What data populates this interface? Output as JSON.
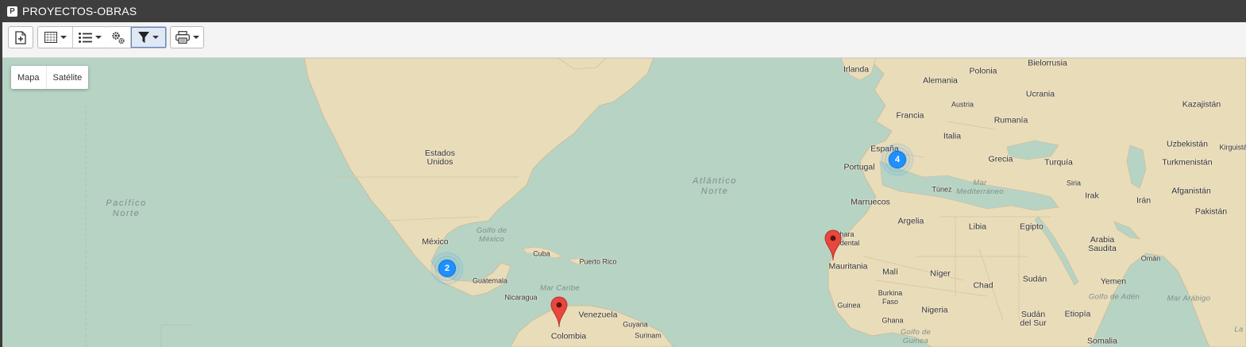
{
  "window": {
    "title": "PROYECTOS-OBRAS",
    "logo_letter": "P"
  },
  "toolbar": {
    "buttons": [
      {
        "name": "new-record-button",
        "icon": "file-plus-icon"
      },
      {
        "name": "grid-view-button",
        "icon": "grid-icon",
        "dropdown": true
      },
      {
        "name": "list-view-button",
        "icon": "list-icon",
        "dropdown": true
      },
      {
        "name": "settings-button",
        "icon": "gears-icon"
      },
      {
        "name": "filter-button",
        "icon": "filter-icon",
        "dropdown": true,
        "active": true
      },
      {
        "name": "print-button",
        "icon": "printer-icon",
        "dropdown": true
      }
    ]
  },
  "map": {
    "type_control": {
      "map": "Mapa",
      "satellite": "Satélite",
      "selected": "Mapa"
    },
    "labels": {
      "irlanda": "Irlanda",
      "polonia": "Polonia",
      "bielorrusia": "Bielorrusia",
      "alemania": "Alemania",
      "ucrania": "Ucrania",
      "austria": "Austria",
      "kazajistan": "Kazajistán",
      "francia": "Francia",
      "rumania": "Rumanía",
      "italia": "Italia",
      "uzbekistan": "Uzbekistán",
      "kirguistan": "Kirguistá",
      "espana": "España",
      "portugal": "Portugal",
      "grecia": "Grecia",
      "turquia": "Turquía",
      "turkmenistan": "Turkmenistán",
      "siria": "Siria",
      "tunez": "Túnez",
      "mar_mediterraneo": "Mar\nMediterráneo",
      "irak": "Irak",
      "afganistan": "Afganistán",
      "iran": "Irán",
      "marruecos": "Marruecos",
      "pakistan": "Pakistán",
      "argelia": "Argelia",
      "libia": "Libia",
      "egipto": "Egipto",
      "arabia_saudita": "Arabia\nSaudita",
      "sahara_occidental": "Sahara\nOccidental",
      "oman": "Omán",
      "mauritania": "Mauritania",
      "mali": "Malí",
      "niger": "Níger",
      "chad": "Chad",
      "sudan": "Sudán",
      "yemen": "Yemen",
      "golfo_aden": "Golfo de Adén",
      "mar_arabigo": "Mar Arábigo",
      "burkina_faso": "Burkina\nFaso",
      "guinea": "Guinea",
      "nigeria": "Nigeria",
      "sudan_sur": "Sudán\ndel Sur",
      "etiopia": "Etiopía",
      "ghana": "Ghana",
      "golfo_guinea": "Golfo de\nGuinea",
      "somalia": "Somalia",
      "estados_unidos": "Estados\nUnidos",
      "atlantico_norte": "Atlántico\nNorte",
      "pacifico_norte": "Pacífico\nNorte",
      "mexico": "México",
      "golfo_mexico": "Golfo de\nMéxico",
      "cuba": "Cuba",
      "puerto_rico": "Puerto Rico",
      "guatemala": "Guatemala",
      "mar_caribe": "Mar Caribe",
      "nicaragua": "Nicaragua",
      "venezuela": "Venezuela",
      "guyana": "Guyana",
      "surinam": "Surinam",
      "colombia": "Colombia",
      "la": "La"
    },
    "clusters": [
      {
        "name": "cluster-mexico",
        "count": "2"
      },
      {
        "name": "cluster-spain",
        "count": "4"
      }
    ],
    "markers": [
      {
        "name": "marker-colombia"
      },
      {
        "name": "marker-mauritania"
      }
    ],
    "colors": {
      "water": "#b7d3c4",
      "land": "#e9dcb9",
      "border": "#c9b99a",
      "cluster": "#1e90ff",
      "marker": "#e8473d"
    }
  }
}
